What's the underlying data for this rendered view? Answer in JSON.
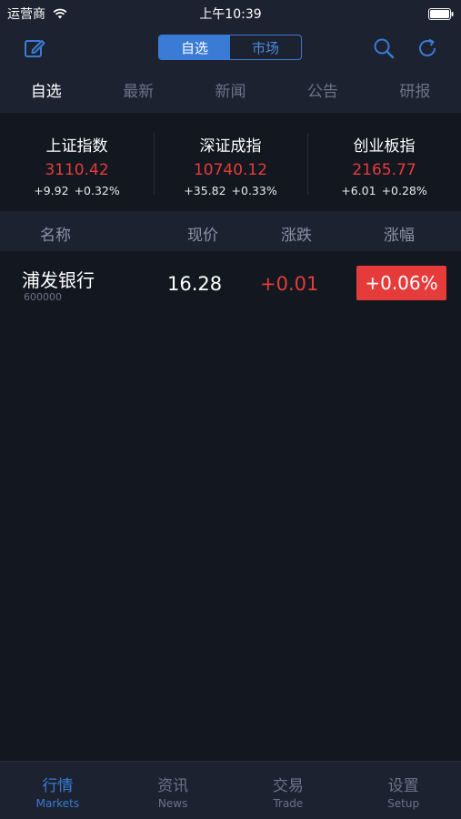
{
  "status_bar": {
    "carrier": "运营商",
    "time": "上午10:39"
  },
  "nav": {
    "segments": [
      {
        "label": "自选",
        "active": true
      },
      {
        "label": "市场",
        "active": false
      }
    ],
    "icons": [
      "edit-icon",
      "search-icon",
      "refresh-icon"
    ],
    "accent_color": "#3a7bd5"
  },
  "subtabs": [
    {
      "label": "自选",
      "active": true
    },
    {
      "label": "最新",
      "active": false
    },
    {
      "label": "新闻",
      "active": false
    },
    {
      "label": "公告",
      "active": false
    },
    {
      "label": "研报",
      "active": false
    }
  ],
  "indices": [
    {
      "name": "上证指数",
      "value": "3110.42",
      "change": "+9.92",
      "pct": "+0.32%"
    },
    {
      "name": "深证成指",
      "value": "10740.12",
      "change": "+35.82",
      "pct": "+0.33%"
    },
    {
      "name": "创业板指",
      "value": "2165.77",
      "change": "+6.01",
      "pct": "+0.28%"
    }
  ],
  "table": {
    "headers": {
      "name": "名称",
      "price": "现价",
      "change": "涨跌",
      "pct": "涨幅"
    },
    "rows": [
      {
        "name": "浦发银行",
        "code": "600000",
        "price": "16.28",
        "change": "+0.01",
        "pct": "+0.06%"
      }
    ]
  },
  "tabbar": [
    {
      "cn": "行情",
      "en": "Markets",
      "active": true
    },
    {
      "cn": "资讯",
      "en": "News",
      "active": false
    },
    {
      "cn": "交易",
      "en": "Trade",
      "active": false
    },
    {
      "cn": "设置",
      "en": "Setup",
      "active": false
    }
  ],
  "colors": {
    "up": "#e53b3b",
    "background": "#131720",
    "panel": "#1c2230"
  }
}
